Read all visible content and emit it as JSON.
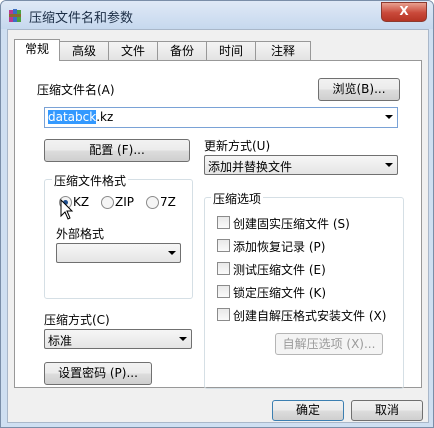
{
  "window": {
    "title": "压缩文件名和参数",
    "close_label": "X",
    "app_icon": "winrar-books-icon"
  },
  "tabs": [
    {
      "label": "常规",
      "active": true
    },
    {
      "label": "高级",
      "active": false
    },
    {
      "label": "文件",
      "active": false
    },
    {
      "label": "备份",
      "active": false
    },
    {
      "label": "时间",
      "active": false
    },
    {
      "label": "注释",
      "active": false
    }
  ],
  "general": {
    "archive_name_label": "压缩文件名(A)",
    "browse_label": "浏览(B)...",
    "archive_name_selected": "databck",
    "archive_name_rest": ".kz",
    "config_label": "配置 (F)...",
    "update_method_label": "更新方式(U)",
    "update_method_value": "添加并替换文件",
    "format_group_label": "压缩文件格式",
    "formats": [
      {
        "label": "KZ",
        "checked": true
      },
      {
        "label": "ZIP",
        "checked": false
      },
      {
        "label": "7Z",
        "checked": false
      }
    ],
    "external_format_label": "外部格式",
    "external_format_value": "",
    "compression_method_label": "压缩方式(C)",
    "compression_method_value": "标准",
    "set_password_label": "设置密码 (P)...",
    "options_group_label": "压缩选项",
    "options": [
      {
        "label": "创建固实压缩文件 (S)",
        "checked": false
      },
      {
        "label": "添加恢复记录 (P)",
        "checked": false
      },
      {
        "label": "测试压缩文件 (E)",
        "checked": false
      },
      {
        "label": "锁定压缩文件 (K)",
        "checked": false
      },
      {
        "label": "创建自解压格式安装文件 (X)",
        "checked": false
      }
    ],
    "sfx_options_label": "自解压选项 (X)..."
  },
  "footer": {
    "ok_label": "确定",
    "cancel_label": "取消"
  }
}
